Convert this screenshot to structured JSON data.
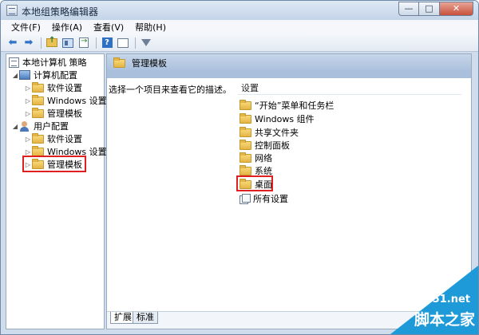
{
  "window": {
    "title": "本地组策略编辑器",
    "controls": {
      "minimize": "—",
      "maximize": "□",
      "close": "✕"
    }
  },
  "menu": {
    "items": [
      "文件(F)",
      "操作(A)",
      "查看(V)",
      "帮助(H)"
    ]
  },
  "toolbar": {
    "icons": [
      "back-arrow-icon",
      "forward-arrow-icon",
      "up-folder-icon",
      "show-hide-tree-icon",
      "export-list-icon",
      "help-icon",
      "properties-icon",
      "filter-icon"
    ]
  },
  "tree": {
    "root": "本地计算机 策略",
    "computer_config": "计算机配置",
    "computer_children": [
      "软件设置",
      "Windows 设置",
      "管理模板"
    ],
    "user_config": "用户配置",
    "user_children": [
      "软件设置",
      "Windows 设置",
      "管理模板"
    ]
  },
  "right": {
    "header_title": "管理模板",
    "description": "选择一个项目来查看它的描述。",
    "list_header": "设置",
    "items": [
      "“开始”菜单和任务栏",
      "Windows 组件",
      "共享文件夹",
      "控制面板",
      "网络",
      "系统",
      "桌面",
      "所有设置"
    ],
    "tabs": [
      "扩展",
      "标准"
    ]
  },
  "watermark": {
    "site": "jb51.net",
    "brand": "脚本之家"
  },
  "colors": {
    "highlight_box": "#e02020",
    "header_blue": "#a9bfdc",
    "watermark_blue": "#1f9ad8"
  }
}
